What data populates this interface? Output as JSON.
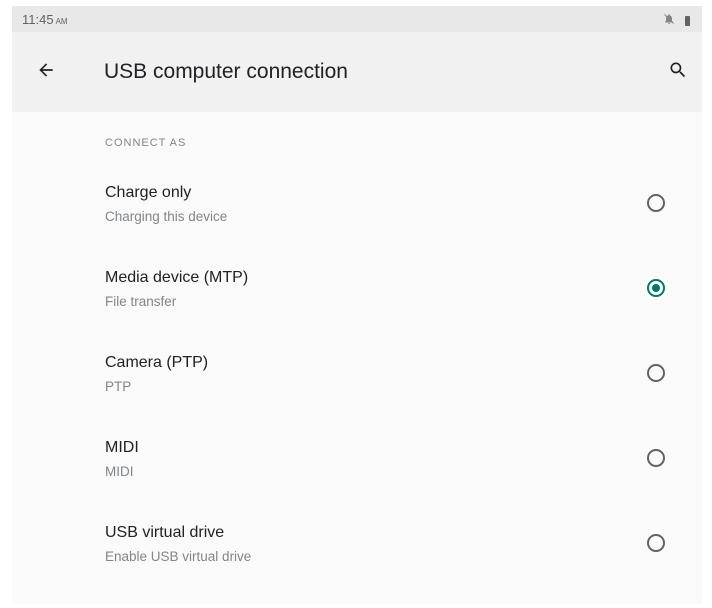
{
  "status_bar": {
    "time": "11:45",
    "ampm": "AM",
    "icons": [
      "notifications-off-icon",
      "battery-icon"
    ]
  },
  "app_bar": {
    "title": "USB computer connection",
    "back_icon": "arrow-back-icon",
    "search_icon": "search-icon"
  },
  "section": {
    "header": "CONNECT AS"
  },
  "options": [
    {
      "title": "Charge only",
      "subtitle": "Charging this device",
      "selected": false
    },
    {
      "title": "Media device (MTP)",
      "subtitle": "File transfer",
      "selected": true
    },
    {
      "title": "Camera (PTP)",
      "subtitle": "PTP",
      "selected": false
    },
    {
      "title": "MIDI",
      "subtitle": "MIDI",
      "selected": false
    },
    {
      "title": "USB virtual drive",
      "subtitle": "Enable USB virtual drive",
      "selected": false
    }
  ],
  "colors": {
    "accent": "#00796b",
    "status_bar": "#e8e8e8",
    "app_bar": "#f1f1f1",
    "background": "#fafafa"
  }
}
